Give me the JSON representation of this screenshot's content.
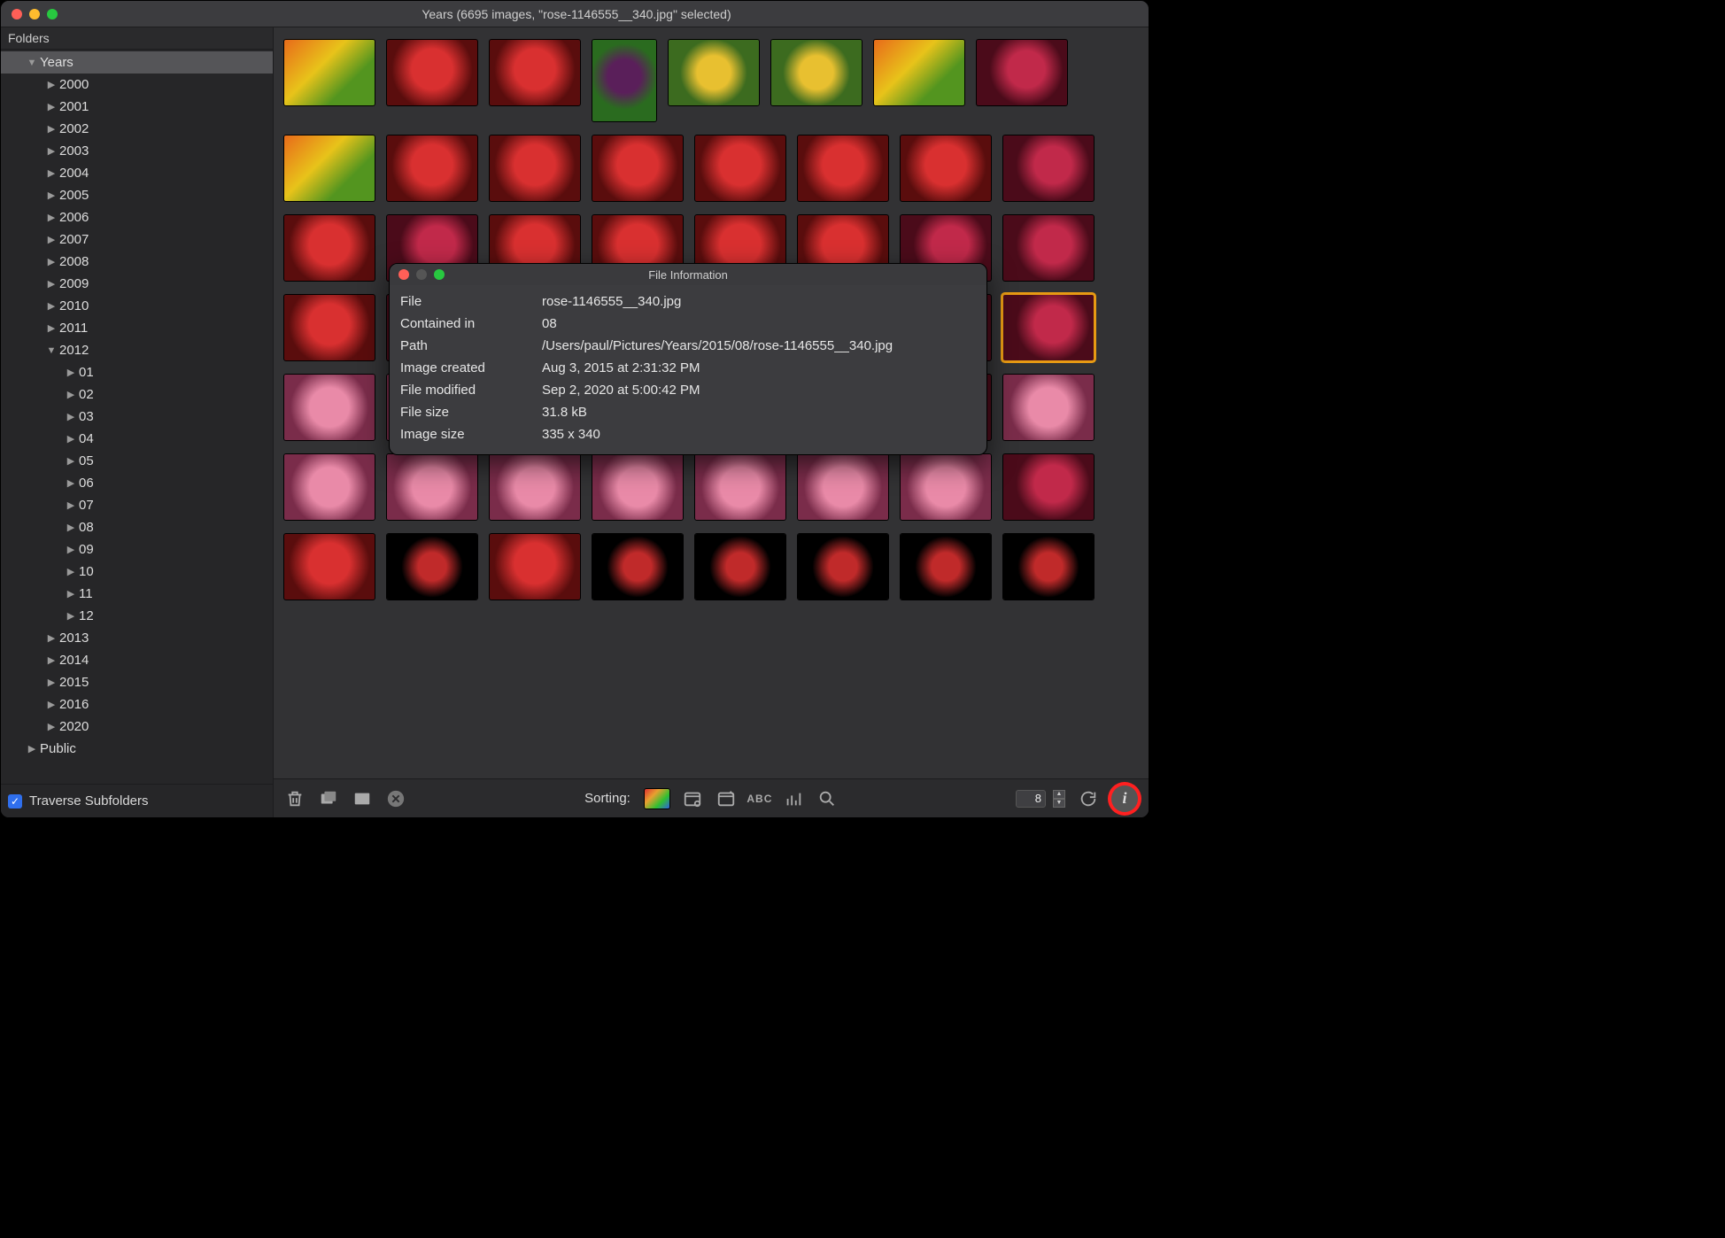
{
  "window": {
    "title": "Years (6695 images, \"rose-1146555__340.jpg\" selected)"
  },
  "sidebar": {
    "header": "Folders",
    "traverse_label": "Traverse Subfolders",
    "traverse_checked": true,
    "tree": [
      {
        "label": "Years",
        "depth": 1,
        "expanded": true,
        "selected": true
      },
      {
        "label": "2000",
        "depth": 2,
        "expanded": false
      },
      {
        "label": "2001",
        "depth": 2,
        "expanded": false
      },
      {
        "label": "2002",
        "depth": 2,
        "expanded": false
      },
      {
        "label": "2003",
        "depth": 2,
        "expanded": false
      },
      {
        "label": "2004",
        "depth": 2,
        "expanded": false
      },
      {
        "label": "2005",
        "depth": 2,
        "expanded": false
      },
      {
        "label": "2006",
        "depth": 2,
        "expanded": false
      },
      {
        "label": "2007",
        "depth": 2,
        "expanded": false
      },
      {
        "label": "2008",
        "depth": 2,
        "expanded": false
      },
      {
        "label": "2009",
        "depth": 2,
        "expanded": false
      },
      {
        "label": "2010",
        "depth": 2,
        "expanded": false
      },
      {
        "label": "2011",
        "depth": 2,
        "expanded": false
      },
      {
        "label": "2012",
        "depth": 2,
        "expanded": true
      },
      {
        "label": "01",
        "depth": 3,
        "expanded": false
      },
      {
        "label": "02",
        "depth": 3,
        "expanded": false
      },
      {
        "label": "03",
        "depth": 3,
        "expanded": false
      },
      {
        "label": "04",
        "depth": 3,
        "expanded": false
      },
      {
        "label": "05",
        "depth": 3,
        "expanded": false
      },
      {
        "label": "06",
        "depth": 3,
        "expanded": false
      },
      {
        "label": "07",
        "depth": 3,
        "expanded": false
      },
      {
        "label": "08",
        "depth": 3,
        "expanded": false
      },
      {
        "label": "09",
        "depth": 3,
        "expanded": false
      },
      {
        "label": "10",
        "depth": 3,
        "expanded": false
      },
      {
        "label": "11",
        "depth": 3,
        "expanded": false
      },
      {
        "label": "12",
        "depth": 3,
        "expanded": false
      },
      {
        "label": "2013",
        "depth": 2,
        "expanded": false
      },
      {
        "label": "2014",
        "depth": 2,
        "expanded": false
      },
      {
        "label": "2015",
        "depth": 2,
        "expanded": false
      },
      {
        "label": "2016",
        "depth": 2,
        "expanded": false
      },
      {
        "label": "2020",
        "depth": 2,
        "expanded": false
      },
      {
        "label": "Public",
        "depth": 1,
        "expanded": false
      }
    ]
  },
  "grid": {
    "thumbnails": [
      {
        "cls": "g-tulip"
      },
      {
        "cls": "g-red"
      },
      {
        "cls": "g-red"
      },
      {
        "cls": "g-purp",
        "tall": true
      },
      {
        "cls": "g-yel"
      },
      {
        "cls": "g-yel"
      },
      {
        "cls": "g-tulip"
      },
      {
        "cls": "g-rose"
      },
      {
        "cls": "g-tulip"
      },
      {
        "cls": "g-red"
      },
      {
        "cls": "g-red"
      },
      {
        "cls": "g-red"
      },
      {
        "cls": "g-red"
      },
      {
        "cls": "g-red"
      },
      {
        "cls": "g-red"
      },
      {
        "cls": "g-rose"
      },
      {
        "cls": "g-red"
      },
      {
        "cls": "g-rose"
      },
      {
        "cls": "g-red"
      },
      {
        "cls": "g-red"
      },
      {
        "cls": "g-red"
      },
      {
        "cls": "g-red"
      },
      {
        "cls": "g-rose"
      },
      {
        "cls": "g-rose"
      },
      {
        "cls": "g-red"
      },
      {
        "cls": "g-rose"
      },
      {
        "cls": "g-red"
      },
      {
        "cls": "g-red"
      },
      {
        "cls": "g-red"
      },
      {
        "cls": "g-red"
      },
      {
        "cls": "g-rose"
      },
      {
        "cls": "g-rose",
        "selected": true
      },
      {
        "cls": "g-pink"
      },
      {
        "cls": "g-pink"
      },
      {
        "cls": "g-pink"
      },
      {
        "cls": "g-tulip"
      },
      {
        "cls": "g-red"
      },
      {
        "cls": "g-pink"
      },
      {
        "cls": "g-rose"
      },
      {
        "cls": "g-pink"
      },
      {
        "cls": "g-pink"
      },
      {
        "cls": "g-pink"
      },
      {
        "cls": "g-pink"
      },
      {
        "cls": "g-pink"
      },
      {
        "cls": "g-pink"
      },
      {
        "cls": "g-pink"
      },
      {
        "cls": "g-pink"
      },
      {
        "cls": "g-rose"
      },
      {
        "cls": "g-red"
      },
      {
        "cls": "g-dark"
      },
      {
        "cls": "g-red"
      },
      {
        "cls": "g-dark"
      },
      {
        "cls": "g-dark"
      },
      {
        "cls": "g-dark"
      },
      {
        "cls": "g-dark"
      },
      {
        "cls": "g-dark"
      }
    ]
  },
  "toolbar": {
    "sorting_label": "Sorting:",
    "columns_value": "8"
  },
  "info": {
    "title": "File Information",
    "rows": [
      {
        "k": "File",
        "v": "rose-1146555__340.jpg"
      },
      {
        "k": "Contained in",
        "v": "08"
      },
      {
        "k": "Path",
        "v": "/Users/paul/Pictures/Years/2015/08/rose-1146555__340.jpg"
      },
      {
        "k": "Image created",
        "v": "Aug 3, 2015 at 2:31:32 PM"
      },
      {
        "k": "File modified",
        "v": "Sep 2, 2020 at 5:00:42 PM"
      },
      {
        "k": "File size",
        "v": "31.8 kB"
      },
      {
        "k": "Image size",
        "v": "335 x 340"
      }
    ]
  }
}
